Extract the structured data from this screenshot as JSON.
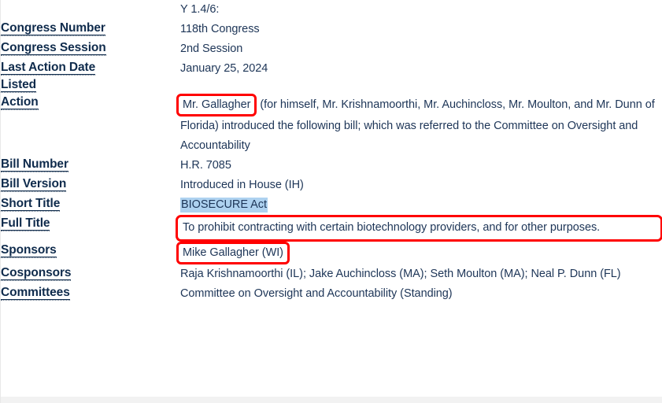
{
  "document": {
    "type": "bill-metadata-record",
    "partial_top_value": "Y 1.4/6:",
    "rows": [
      {
        "label": "",
        "value": "Y 1.4/6:"
      },
      {
        "label": "Congress Number",
        "value": "118th Congress"
      },
      {
        "label": "Congress Session",
        "value": "2nd Session"
      },
      {
        "label": "Last Action Date Listed",
        "label_line1": "Last Action Date",
        "label_line2": "Listed",
        "value": "January 25, 2024"
      },
      {
        "label": "Action",
        "value_highlighted": "Mr. Gallagher",
        "value_rest": " (for himself, Mr. Krishnamoorthi, Mr. Auchincloss, Mr. Moulton, and Mr. Dunn of Florida) introduced the following bill; which was referred to the Committee on Oversight and Accountability"
      },
      {
        "label": "Bill Number",
        "value": "H.R. 7085"
      },
      {
        "label": "Bill Version",
        "value": "Introduced in House (IH)"
      },
      {
        "label": "Short Title",
        "value": "BIOSECURE Act"
      },
      {
        "label": "Full Title",
        "value": "To prohibit contracting with certain biotechnology providers, and for other purposes."
      },
      {
        "label": "Sponsors",
        "value": "Mike Gallagher (WI)"
      },
      {
        "label": "Cosponsors",
        "value": "Raja Krishnamoorthi (IL); Jake Auchincloss (MA); Seth Moulton (MA); Neal P. Dunn (FL)"
      },
      {
        "label": "Committees",
        "value": "Committee on Oversight and Accountability (Standing)"
      }
    ]
  },
  "annotations": {
    "red_box_color": "#ff0000",
    "selection_highlight_color": "#aed2f0",
    "boxed_fields": [
      "Action",
      "Full Title",
      "Sponsors"
    ],
    "highlighted_fields": [
      "Short Title"
    ]
  },
  "colors": {
    "label_text": "#0f2b4c",
    "value_text": "#1d3557",
    "background": "#ffffff",
    "bottom_band": "#f2f2f2"
  }
}
